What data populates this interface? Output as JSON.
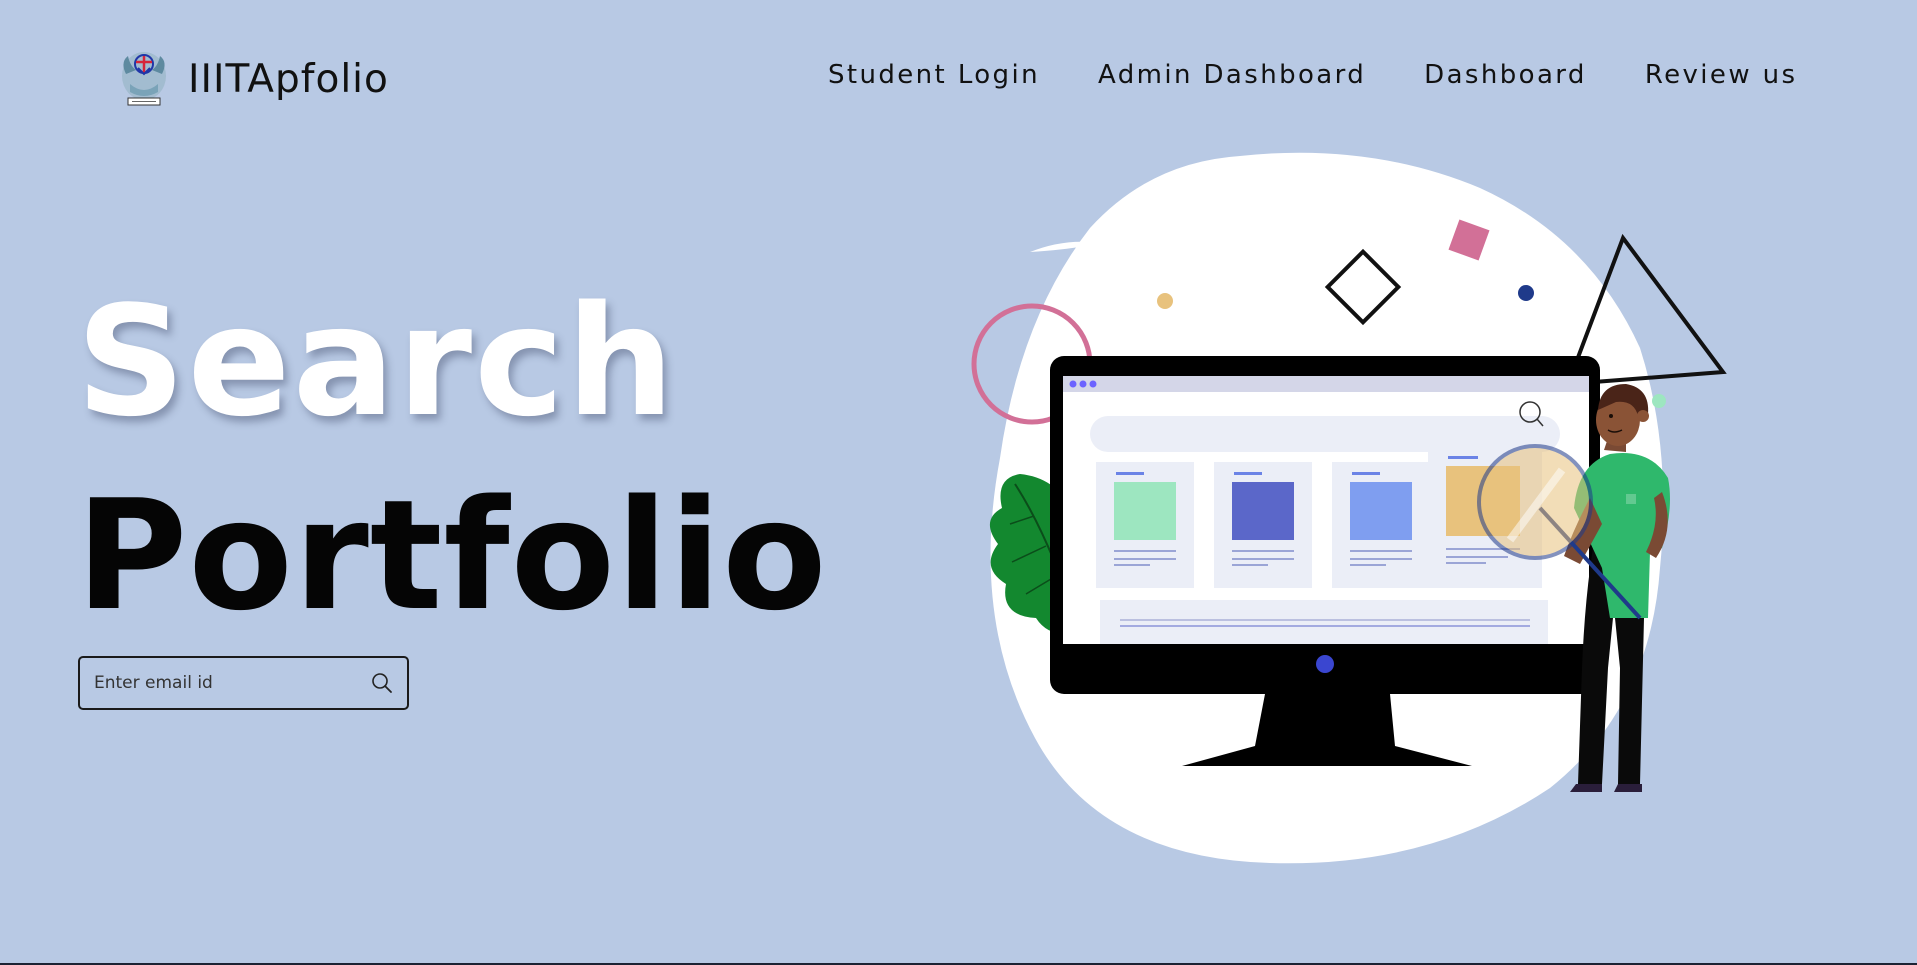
{
  "brand": {
    "name": "IIITApfolio",
    "logo_icon": "institute-emblem-icon"
  },
  "nav": {
    "items": [
      {
        "label": "Student Login"
      },
      {
        "label": "Admin Dashboard"
      },
      {
        "label": "Dashboard"
      },
      {
        "label": "Review us"
      }
    ]
  },
  "hero": {
    "line1": "Search",
    "line2": "Portfolio"
  },
  "search": {
    "placeholder": "Enter email id",
    "value": "",
    "icon": "search-icon"
  },
  "colors": {
    "background": "#b8c9e4",
    "hero_line1": "#ffffff",
    "hero_line2": "#050505",
    "illustration_blob": "#ffffff",
    "accent_pink": "#d27097",
    "accent_green": "#2fb86c",
    "accent_blue": "#5b67c9"
  },
  "illustration": {
    "description_icon": "portfolio-search-illustration"
  }
}
